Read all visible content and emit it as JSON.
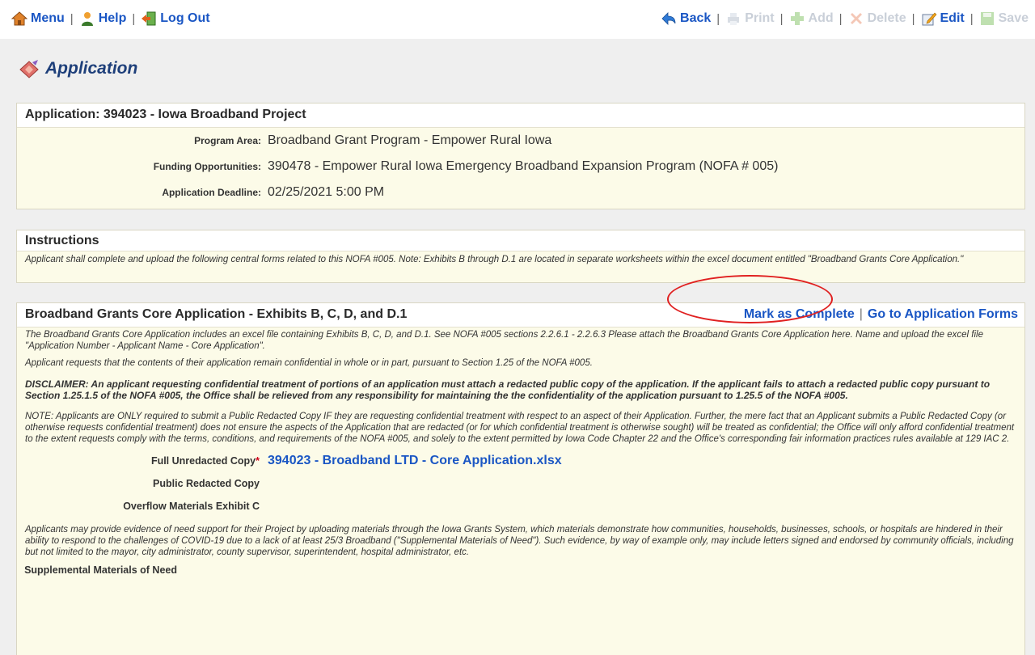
{
  "nav": {
    "menu": "Menu",
    "help": "Help",
    "logout": "Log Out",
    "back": "Back",
    "print": "Print",
    "add": "Add",
    "delete": "Delete",
    "edit": "Edit",
    "save": "Save",
    "separator": "|"
  },
  "page": {
    "title": "Application"
  },
  "app_panel": {
    "header": "Application: 394023 - Iowa Broadband Project",
    "fields": [
      {
        "label": "Program Area:",
        "value": "Broadband Grant Program - Empower Rural Iowa"
      },
      {
        "label": "Funding Opportunities:",
        "value": "390478 - Empower Rural Iowa Emergency Broadband Expansion Program (NOFA # 005)"
      },
      {
        "label": "Application Deadline:",
        "value": "02/25/2021 5:00 PM"
      }
    ]
  },
  "instructions": {
    "header": "Instructions",
    "text": "Applicant shall complete and upload the following central forms related to this NOFA #005. Note: Exhibits B through D.1 are located in separate worksheets within the excel document entitled \"Broadband Grants Core Application.\""
  },
  "core": {
    "header": "Broadband Grants Core Application - Exhibits B, C, D, and D.1",
    "mark_complete": "Mark as Complete",
    "go_to_forms": "Go to Application Forms",
    "intro": "The Broadband Grants Core Application includes an excel file containing Exhibits B, C, D, and D.1. See NOFA #005 sections 2.2.6.1 - 2.2.6.3 Please attach the Broadband Grants Core Application here. Name and upload the excel file \"Application Number - Applicant Name - Core Application\".",
    "confidential_request": "Applicant requests that the contents of their application remain confidential in whole or in part, pursuant to Section 1.25 of the NOFA #005.",
    "disclaimer": "DISCLAIMER: An applicant requesting confidential treatment of portions of an application must attach a redacted public copy of the application. If the applicant fails to attach a redacted public copy pursuant to Section 1.25.1.5 of the NOFA #005, the Office shall be relieved from any responsibility for maintaining the the confidentiality of the application pursuant to 1.25.5 of the NOFA #005.",
    "note": "NOTE: Applicants are ONLY required to submit a Public Redacted Copy IF they are requesting confidential treatment with respect to an aspect of their Application. Further, the mere fact that an Applicant submits a Public Redacted Copy (or otherwise requests confidential treatment) does not ensure the aspects of the Application that are redacted (or for which confidential treatment is otherwise sought) will be treated as confidential; the Office will only afford confidential treatment to the extent requests comply with the terms, conditions, and requirements of the NOFA #005, and solely to the extent permitted by Iowa Code Chapter 22 and the Office's corresponding fair information practices rules available at 129 IAC 2.",
    "full_copy_label": "Full Unredacted Copy",
    "required_mark": "*",
    "full_copy_file": "394023 - Broadband LTD - Core Application.xlsx",
    "public_copy_label": "Public Redacted Copy",
    "overflow_label": "Overflow Materials Exhibit C",
    "supplemental_text": "Applicants may provide evidence of need support for their Project by uploading materials through the Iowa Grants System, which materials demonstrate how communities, households, businesses, schools, or hospitals are hindered in their ability to respond to the challenges of COVID-19 due to a lack of at least 25/3 Broadband (\"Supplemental Materials of Need\"). Such evidence, by way of example only, may include letters signed and endorsed by community officials, including but not limited to the mayor, city administrator, county supervisor, superintendent, hospital administrator, etc.",
    "supplemental_label": "Supplemental Materials of Need"
  }
}
